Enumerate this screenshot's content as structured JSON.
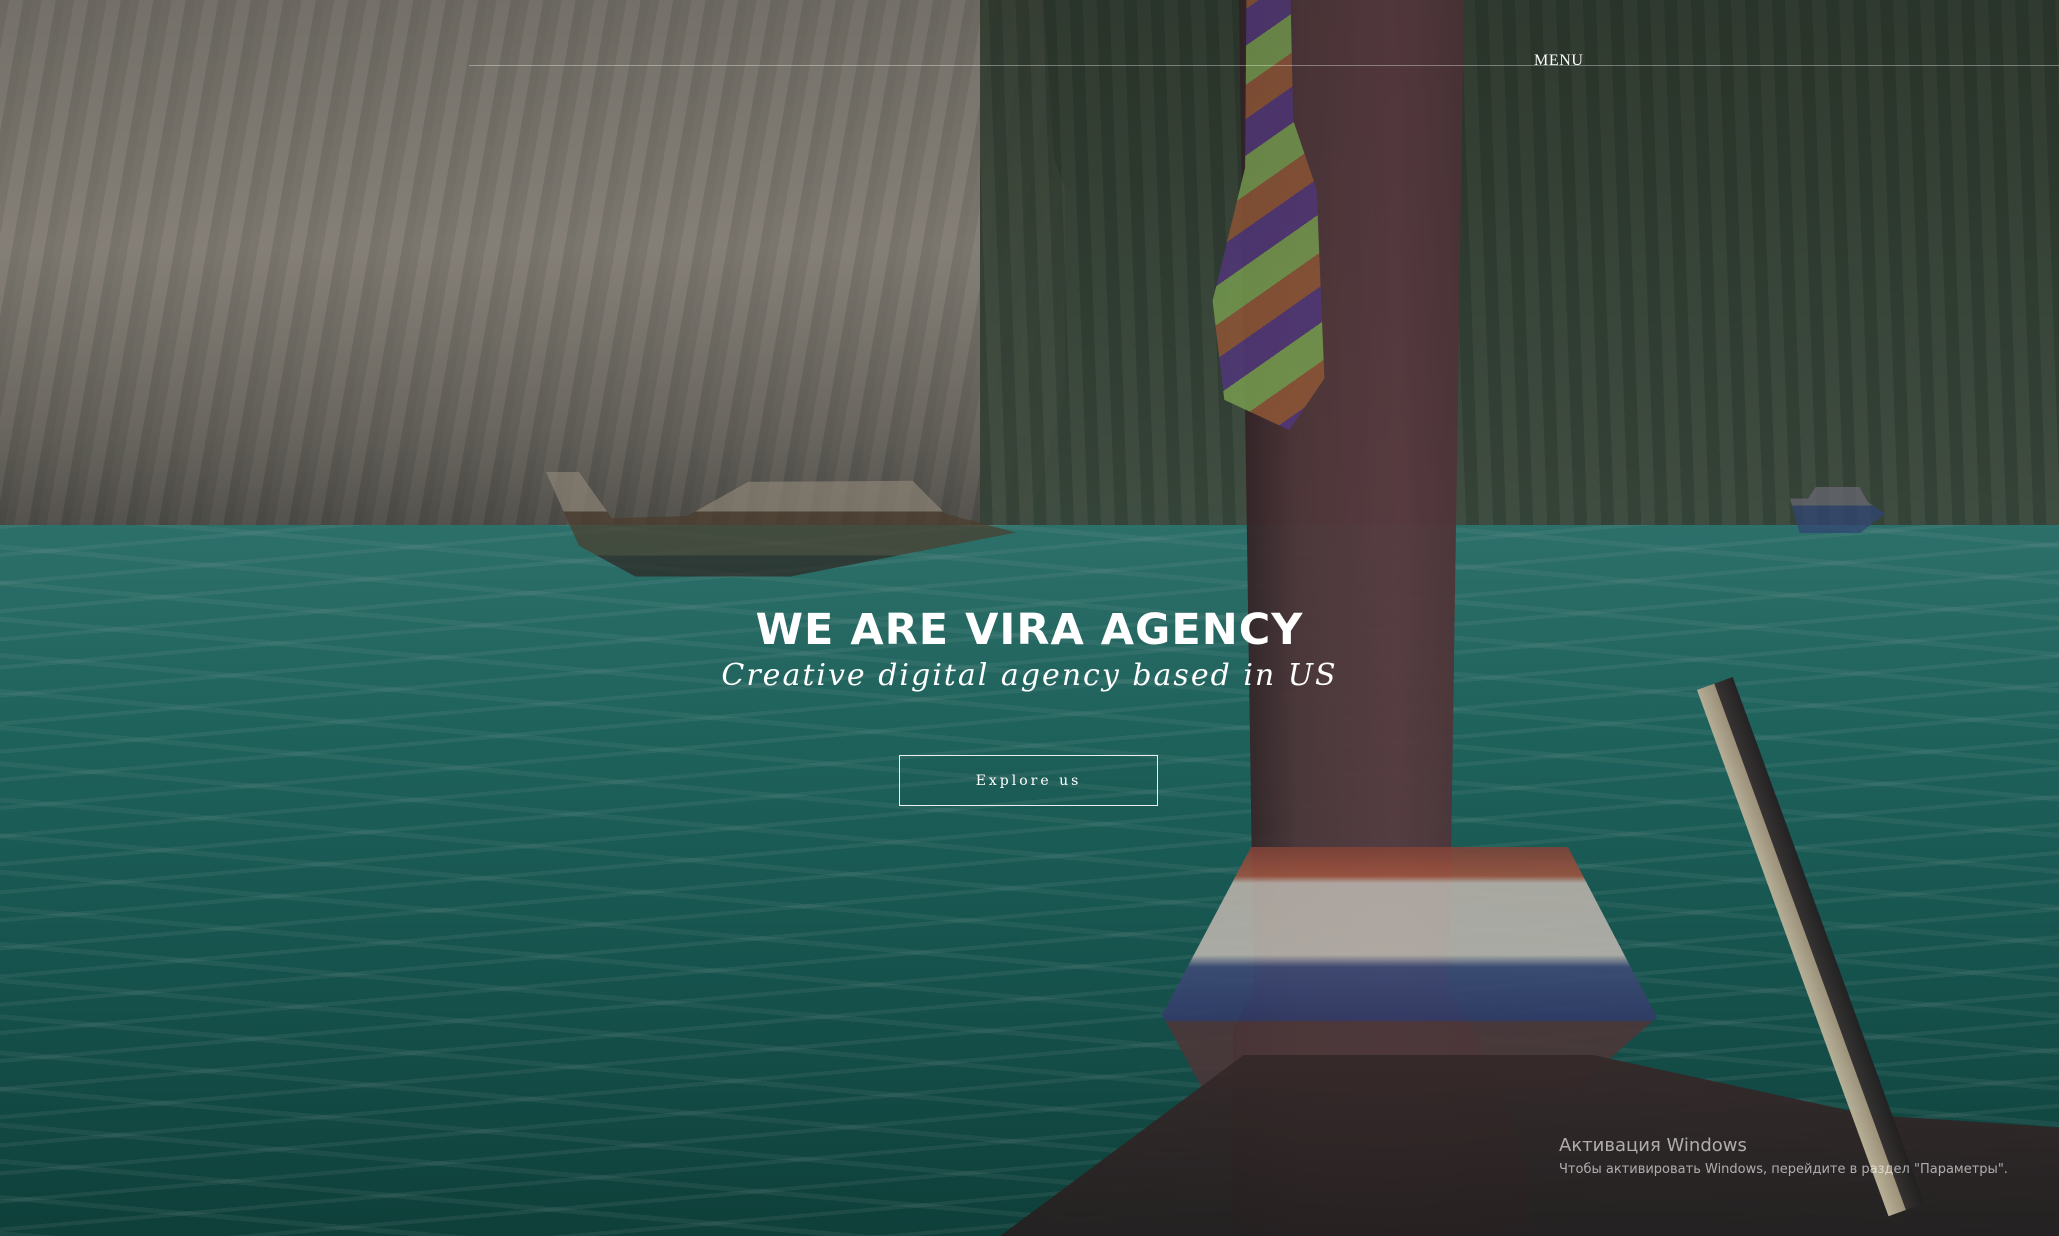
{
  "navigation": {
    "menu_label": "MENU"
  },
  "hero": {
    "title": "WE ARE VIRA AGENCY",
    "subtitle": "Creative digital agency based in US",
    "button_label": "Explore us"
  },
  "watermark": {
    "title": "Активация Windows",
    "message": "Чтобы активировать Windows, перейдите в раздел \"Параметры\"."
  },
  "colors": {
    "text": "#ffffff",
    "button_border": "#ffffff",
    "water": "#1d766d"
  }
}
